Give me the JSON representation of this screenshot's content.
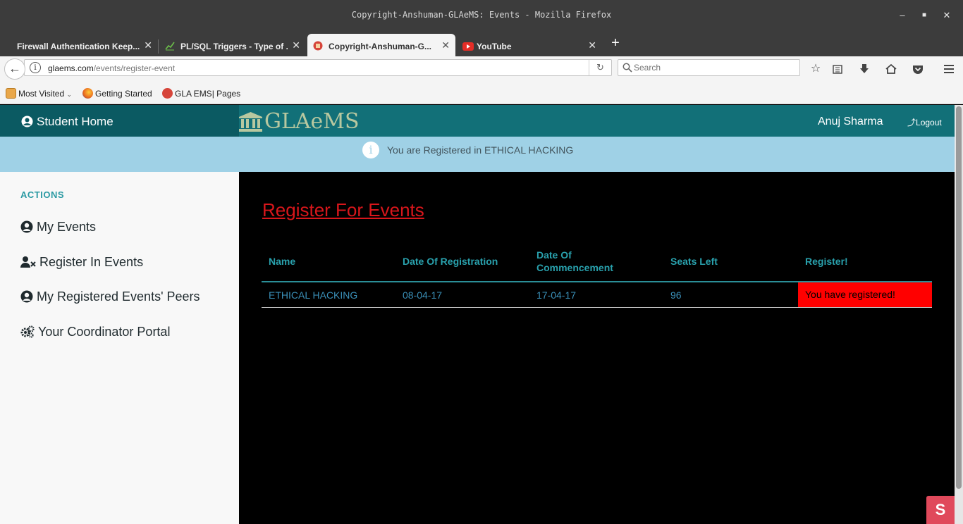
{
  "window": {
    "title": "Copyright-Anshuman-GLAeMS: Events - Mozilla Firefox"
  },
  "tabs": [
    {
      "label": "Firewall Authentication Keep...",
      "icon": "none"
    },
    {
      "label": "PL/SQL Triggers - Type of ...",
      "icon": "chart-favicon"
    },
    {
      "label": "Copyright-Anshuman-G...",
      "icon": "glaems-favicon",
      "active": true
    },
    {
      "label": "YouTube",
      "icon": "youtube-favicon"
    }
  ],
  "navbar": {
    "url_domain": "glaems.com",
    "url_path": "/events/register-event",
    "search_placeholder": "Search"
  },
  "bookmarks": [
    {
      "label": "Most Visited",
      "icon": "folder-icon"
    },
    {
      "label": "Getting Started",
      "icon": "firefox-icon"
    },
    {
      "label": "GLA EMS| Pages",
      "icon": "glaems-icon"
    }
  ],
  "app": {
    "student_home": "Student Home",
    "brand": "GLAeMS",
    "username": "Anuj Sharma",
    "logout": "Logout",
    "notice": "You are Registered in ETHICAL HACKING"
  },
  "sidebar": {
    "heading": "ACTIONS",
    "items": [
      {
        "label": "My Events",
        "icon": "user-circle-icon"
      },
      {
        "label": "Register In Events",
        "icon": "user-times-icon"
      },
      {
        "label": "My Registered Events' Peers",
        "icon": "user-circle-icon"
      },
      {
        "label": "Your Coordinator Portal",
        "icon": "gears-icon"
      }
    ]
  },
  "main": {
    "title": "Register For Events",
    "columns": [
      "Name",
      "Date Of Registration",
      "Date Of Commencement",
      "Seats Left",
      "Register!"
    ],
    "rows": [
      {
        "name": "ETHICAL HACKING",
        "date_registration": "08-04-17",
        "date_commencement": "17-04-17",
        "seats_left": "96",
        "register": "You have registered!"
      }
    ]
  },
  "colors": {
    "appbar": "#127078",
    "notice": "#9fd1e6",
    "title_red": "#d8161b",
    "register_cell": "#ff0000",
    "table_header": "#29a1ad"
  }
}
